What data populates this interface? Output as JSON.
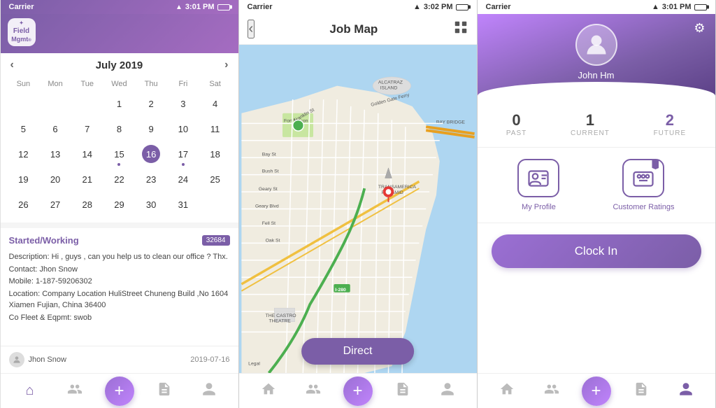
{
  "screen1": {
    "status": {
      "carrier": "Carrier",
      "time": "3:01 PM"
    },
    "appName": "Field\nMgmt",
    "calendar": {
      "month": "July 2019",
      "days_of_week": [
        "Sun",
        "Mon",
        "Tue",
        "Wed",
        "Thu",
        "Fri",
        "Sat"
      ],
      "weeks": [
        [
          "",
          "",
          "",
          "1",
          "2",
          "3",
          "4",
          "5",
          "6"
        ],
        [
          "7",
          "8",
          "9",
          "10",
          "11",
          "12",
          "13"
        ],
        [
          "14",
          "15",
          "16",
          "17",
          "18",
          "19",
          "20"
        ],
        [
          "21",
          "22",
          "23",
          "24",
          "25",
          "26",
          "27"
        ],
        [
          "28",
          "29",
          "30",
          "31",
          "",
          "",
          ""
        ]
      ],
      "today": "16",
      "dot_days": [
        "15",
        "17"
      ]
    },
    "job": {
      "status": "Started/Working",
      "id": "32684",
      "description": "Description: Hi , guys , can you help us to clean our office ? Thx.",
      "contact": "Contact: Jhon Snow",
      "mobile": "Mobile: 1-187-59206302",
      "location": "Location:  Company Location HuliStreet Chuneng Build ,No 1604 Xiamen Fujian, China 36400",
      "cofleet": "Co Fleet & Eqpmt: swob",
      "assignee": "Jhon Snow",
      "date": "2019-07-16"
    },
    "nav": {
      "home": "⌂",
      "people": "👥",
      "add": "+",
      "docs": "📄",
      "person": "👤"
    }
  },
  "screen2": {
    "status": {
      "carrier": "Carrier",
      "time": "3:02 PM"
    },
    "title": "Job Map",
    "back_label": "‹",
    "direct_label": "Direct",
    "map_labels": [
      "ALCATRAZ ISLAND",
      "Golden Gate Ferry",
      "BAY BRIDGE",
      "Fort Mason",
      "Bay St",
      "Bush St",
      "Geary St",
      "Geary Blvd",
      "Fell St",
      "Oak St",
      "TRANSAMERICA PYRAMID",
      "THE CASTRO THEATRE",
      "Legal",
      "I-280"
    ]
  },
  "screen3": {
    "status": {
      "carrier": "Carrier",
      "time": "3:01 PM"
    },
    "username": "John Hm",
    "stats": {
      "past": {
        "value": "0",
        "label": "PAST"
      },
      "current": {
        "value": "1",
        "label": "CURRENT"
      },
      "future": {
        "value": "2",
        "label": "FUTURE"
      }
    },
    "actions": {
      "profile": {
        "label": "My Profile"
      },
      "ratings": {
        "label": "Customer Ratings"
      }
    },
    "clock_in": "Clock In",
    "nav": {
      "home": "⌂",
      "people": "👥",
      "add": "+",
      "docs": "📄",
      "person": "👤"
    }
  },
  "colors": {
    "purple": "#7b5ea7",
    "light_purple": "#c084fc",
    "accent": "#9b6fd4"
  }
}
